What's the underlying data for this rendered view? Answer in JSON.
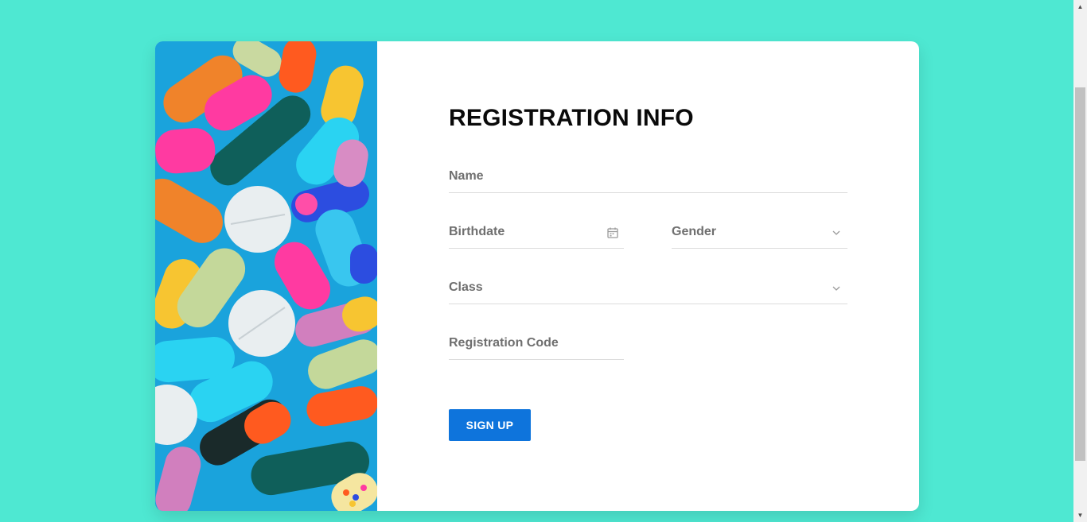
{
  "form": {
    "title": "REGISTRATION INFO",
    "name_placeholder": "Name",
    "birthdate_placeholder": "Birthdate",
    "gender_placeholder": "Gender",
    "class_placeholder": "Class",
    "registration_code_placeholder": "Registration Code",
    "submit_label": "SIGN UP"
  },
  "icons": {
    "birthdate": "calendar-icon",
    "gender": "chevron-down-icon",
    "class": "chevron-down-icon"
  },
  "colors": {
    "page_background": "#4ee8d2",
    "button": "#0e74dc",
    "card": "#ffffff"
  }
}
